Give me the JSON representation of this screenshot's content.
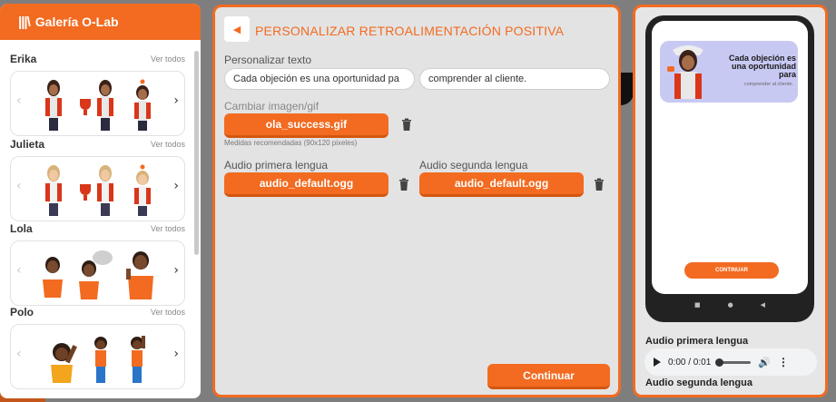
{
  "gallery": {
    "title": "Galería O-Lab",
    "see_all": "Ver todos",
    "characters": [
      {
        "name": "Erika"
      },
      {
        "name": "Julieta"
      },
      {
        "name": "Lola"
      },
      {
        "name": "Polo"
      }
    ]
  },
  "editor": {
    "title": "PERSONALIZAR RETROALIMENTACIÓN POSITIVA",
    "text_label": "Personalizar texto",
    "text_value_1": "Cada objeción es una oportunidad pa",
    "text_value_2": "comprender al cliente.",
    "image_label": "Cambiar imagen/gif",
    "image_file": "ola_success.gif",
    "image_hint": "Medidas recomendadas (90x120 pixeles)",
    "audio1_label": "Audio primera lengua",
    "audio1_file": "audio_default.ogg",
    "audio2_label": "Audio segunda lengua",
    "audio2_file": "audio_default.ogg",
    "continue": "Continuar"
  },
  "preview": {
    "banner_title": "Cada objeción es una oportunidad para",
    "banner_sub": "comprender al cliente.",
    "phone_button": "CONTINUAR",
    "audio1_label": "Audio primera lengua",
    "audio1_time": "0:00 / 0:01",
    "audio2_label": "Audio segunda lengua"
  },
  "colors": {
    "accent": "#f26b21",
    "banner": "#c8c9f3"
  }
}
